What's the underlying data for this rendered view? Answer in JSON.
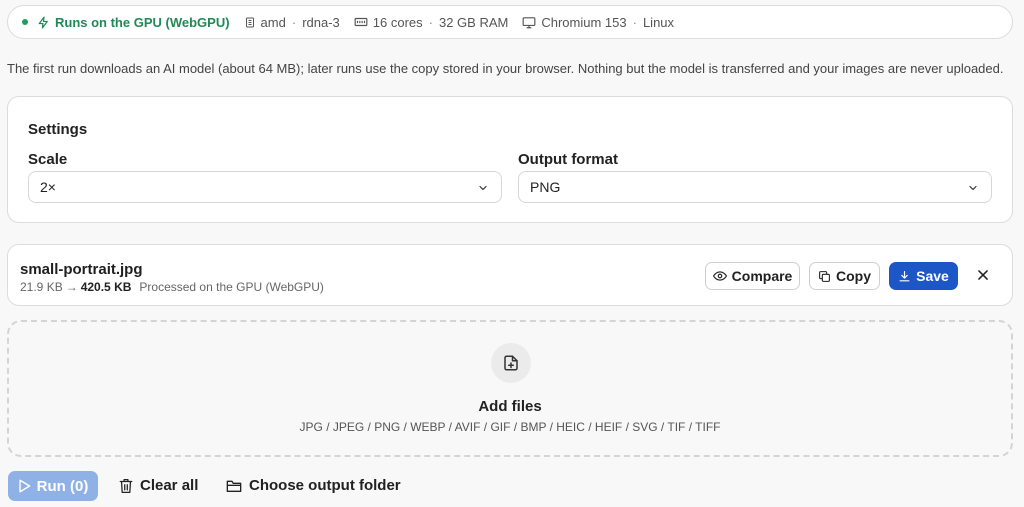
{
  "status": {
    "gpu_label": "Runs on the GPU (WebGPU)",
    "vendor": "amd",
    "architecture": "rdna-3",
    "cores": "16 cores",
    "ram": "32 GB RAM",
    "browser": "Chromium 153",
    "os": "Linux",
    "separator": "·"
  },
  "intro": "The first run downloads an AI model (about 64 MB); later runs use the copy stored in your browser. Nothing but the model is transferred and your images are never uploaded.",
  "settings": {
    "title": "Settings",
    "scale_label": "Scale",
    "scale_value": "2×",
    "format_label": "Output format",
    "format_value": "PNG"
  },
  "file": {
    "name": "small-portrait.jpg",
    "input_size": "21.9 KB",
    "arrow": "→",
    "output_size": "420.5 KB",
    "note": "Processed on the GPU (WebGPU)",
    "compare_label": "Compare",
    "copy_label": "Copy",
    "save_label": "Save"
  },
  "dropzone": {
    "title": "Add files",
    "formats": "JPG / JPEG / PNG / WEBP / AVIF / GIF / BMP / HEIC / HEIF / SVG / TIF / TIFF"
  },
  "actions": {
    "run_label": "Run (0)",
    "clear_label": "Clear all",
    "folder_label": "Choose output folder"
  },
  "colors": {
    "accent": "#1d56c7",
    "accent_disabled": "#8fb1e6",
    "status_green": "#1f8a55"
  }
}
